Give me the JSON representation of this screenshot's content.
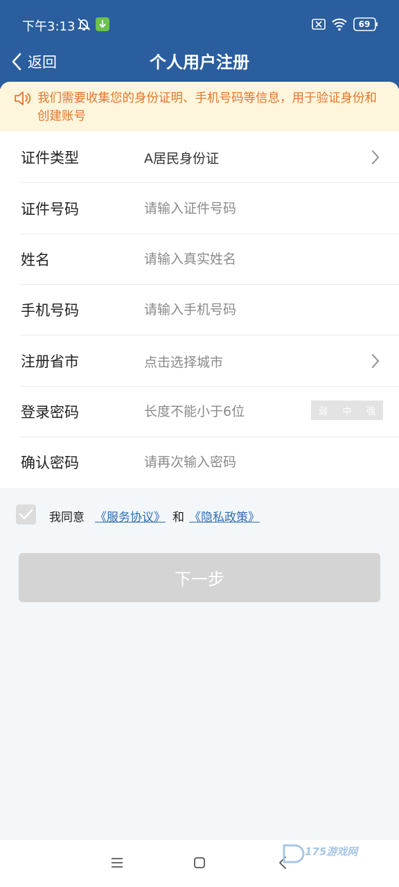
{
  "status_bar": {
    "time": "下午3:13",
    "battery": "69"
  },
  "nav": {
    "back_label": "返回",
    "title": "个人用户注册"
  },
  "notice": {
    "text": "我们需要收集您的身份证明、手机号码等信息，用于验证身份和创建账号"
  },
  "form": {
    "rows": [
      {
        "label": "证件类型",
        "value": "A居民身份证"
      },
      {
        "label": "证件号码",
        "placeholder": "请输入证件号码"
      },
      {
        "label": "姓名",
        "placeholder": "请输入真实姓名"
      },
      {
        "label": "手机号码",
        "placeholder": "请输入手机号码"
      },
      {
        "label": "注册省市",
        "value": "点击选择城市"
      },
      {
        "label": "登录密码",
        "placeholder": "长度不能小于6位"
      },
      {
        "label": "确认密码",
        "placeholder": "请再次输入密码"
      }
    ],
    "strength": [
      "弱",
      "中",
      "强"
    ]
  },
  "agreement": {
    "prefix": "我同意",
    "service_link": "《服务协议》",
    "and": "和",
    "privacy_link": "《隐私政策》"
  },
  "next_button": "下一步",
  "watermark": "175游戏网",
  "colors": {
    "header": "#2a5e9e",
    "notice_bg": "#fdf6dd",
    "notice_text": "#e5762b",
    "link": "#2f6cb4",
    "disabled_button": "#d4d4d4"
  }
}
